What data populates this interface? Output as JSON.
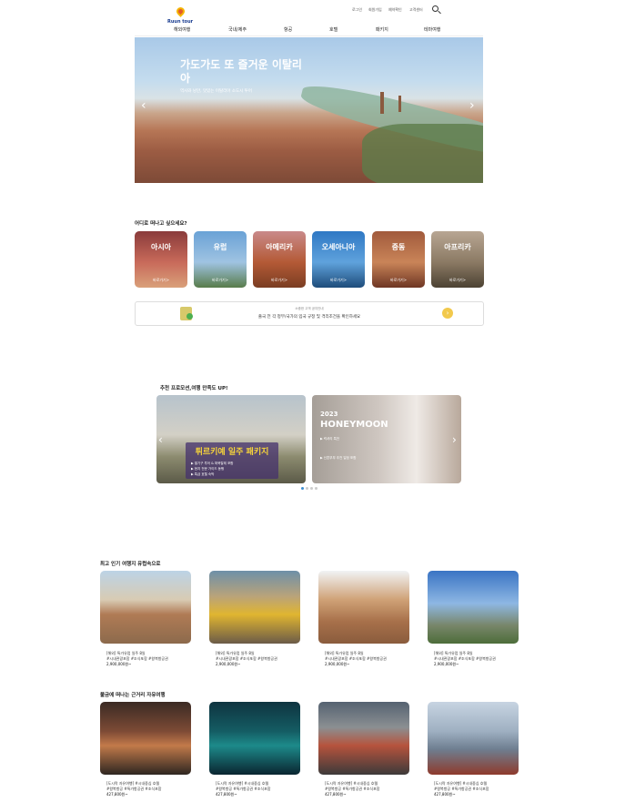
{
  "header": {
    "logo_text": "Ruun tour",
    "util_links": [
      "로그인",
      "회원가입",
      "예약확인",
      "고객센터"
    ]
  },
  "nav": [
    "해외여행",
    "국내/제주",
    "항공",
    "호텔",
    "패키지",
    "테마여행"
  ],
  "hero": {
    "title": "가도가도 또 즐거운 이탈리아",
    "subtitle": "역사와 낭만, 맛있는 이탈리아 소도시 투어",
    "prev": "‹",
    "next": "›"
  },
  "regions": {
    "title": "어디로 떠나고 싶으세요?",
    "go_label": "바로가기>",
    "items": [
      "아시아",
      "유럽",
      "아메리카",
      "오세아니아",
      "중동",
      "아프리카"
    ]
  },
  "notice": {
    "line1": "소중한 고객 공지안내",
    "line2": "출국 전 각 정부/국가의 입국 규정 및 격리조건을 확인하세요",
    "btn": "›"
  },
  "promo": {
    "title": "추천 프로모션,여행 만족도 UP!",
    "turkey_title": "튀르키예 일주 패키지",
    "turkey_l1": "▶ 열기구 투어 & 파묵칼레 포함",
    "turkey_l2": "▶ 현지 전문 가이드 동행",
    "turkey_l3": "▶ 특급 호텔 숙박",
    "hm_year": "2023",
    "hm_title": "HONEYMOON",
    "hm_l1": "▶ 럭셔리 특전",
    "hm_l2": "▶ 신혼부부 추천 일정 포함",
    "prev": "‹",
    "next": "›"
  },
  "popular": {
    "title": "최고 인기 여행지 유럽속으로",
    "items": [
      {
        "l1": "[해외] 특가유럽 일주 8일",
        "l2": "#시내관광포함 #조식포함 #왕복항공권",
        "price": "2,900,000원~"
      },
      {
        "l1": "[해외] 특가유럽 일주 8일",
        "l2": "#시내관광포함 #조식포함 #왕복항공권",
        "price": "2,900,000원~"
      },
      {
        "l1": "[해외] 특가유럽 일주 8일",
        "l2": "#시내관광포함 #조식포함 #왕복항공권",
        "price": "2,900,000원~"
      },
      {
        "l1": "[해외] 특가유럽 일주 8일",
        "l2": "#시내관광포함 #조식포함 #왕복항공권",
        "price": "2,900,000원~"
      }
    ]
  },
  "nearby": {
    "title": "불금에 떠나는 근거리 자유여행",
    "items": [
      {
        "l1": "[도시락 자유여행] #시내중심 호텔",
        "l2": "#왕복항공 #특가항공권 #조식포함",
        "price": "427,800원~"
      },
      {
        "l1": "[도시락 자유여행] #시내중심 호텔",
        "l2": "#왕복항공 #특가항공권 #조식포함",
        "price": "427,800원~"
      },
      {
        "l1": "[도시락 자유여행] #시내중심 호텔",
        "l2": "#왕복항공 #특가항공권 #조식포함",
        "price": "427,800원~"
      },
      {
        "l1": "[도시락 자유여행] #시내중심 호텔",
        "l2": "#왕복항공 #특가항공권 #조식포함",
        "price": "427,800원~"
      }
    ]
  }
}
